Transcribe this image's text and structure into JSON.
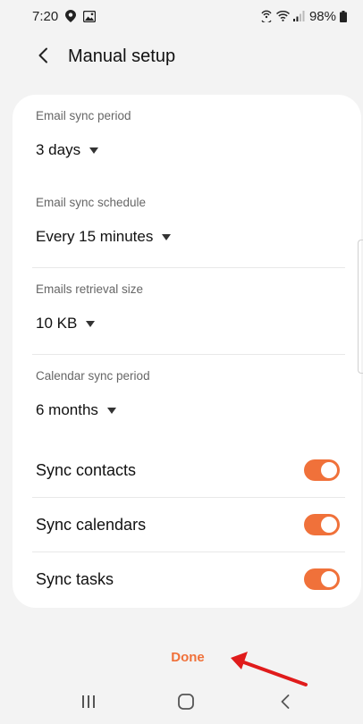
{
  "status_bar": {
    "time": "7:20",
    "battery": "98%",
    "icons": [
      "location-icon",
      "gallery-icon",
      "hotspot-icon",
      "wifi-icon",
      "signal-icon",
      "battery-icon"
    ]
  },
  "header": {
    "title": "Manual setup",
    "back_icon": "chevron-left-icon"
  },
  "settings": {
    "dropdowns": [
      {
        "label": "Email sync period",
        "value": "3 days"
      },
      {
        "label": "Email sync schedule",
        "value": "Every 15 minutes"
      },
      {
        "label": "Emails retrieval size",
        "value": "10 KB"
      },
      {
        "label": "Calendar sync period",
        "value": "6 months"
      }
    ],
    "toggles": [
      {
        "label": "Sync contacts",
        "on": true
      },
      {
        "label": "Sync calendars",
        "on": true
      },
      {
        "label": "Sync tasks",
        "on": true
      }
    ]
  },
  "footer": {
    "done_label": "Done"
  },
  "colors": {
    "accent": "#f0713a",
    "annotation_arrow": "#e01b1b",
    "background": "#f3f3f3",
    "card": "#ffffff"
  },
  "nav_bar": {
    "icons": [
      "recent-apps-icon",
      "home-icon",
      "back-icon"
    ]
  }
}
